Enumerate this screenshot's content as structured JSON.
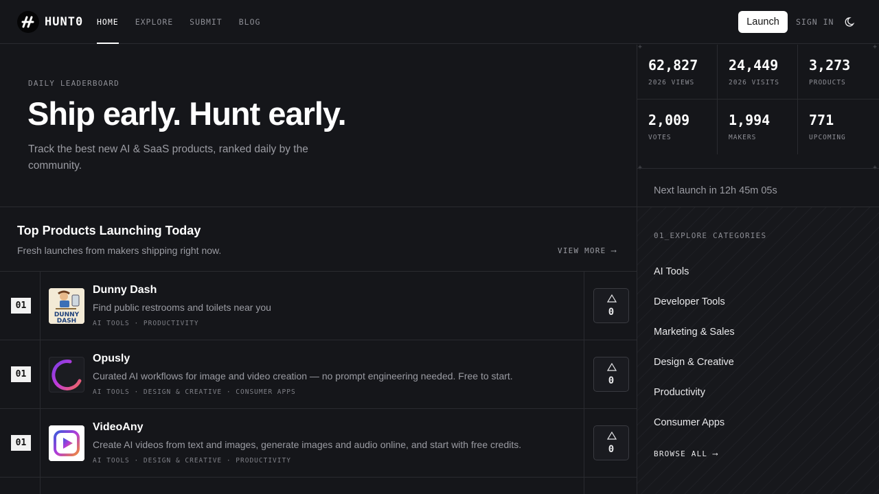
{
  "header": {
    "brand": "HUNT0",
    "nav": [
      "HOME",
      "EXPLORE",
      "SUBMIT",
      "BLOG"
    ],
    "active_nav": "HOME",
    "launch_label": "Launch",
    "signin_label": "SIGN IN"
  },
  "hero": {
    "eyebrow": "DAILY LEADERBOARD",
    "headline": "Ship early. Hunt early.",
    "subline": "Track the best new AI & SaaS products, ranked daily by the community."
  },
  "stats": [
    {
      "value": "62,827",
      "label": "2026 VIEWS"
    },
    {
      "value": "24,449",
      "label": "2026 VISITS"
    },
    {
      "value": "3,273",
      "label": "PRODUCTS"
    },
    {
      "value": "2,009",
      "label": "VOTES"
    },
    {
      "value": "1,994",
      "label": "MAKERS"
    },
    {
      "value": "771",
      "label": "UPCOMING"
    }
  ],
  "next_launch": "Next launch in 12h 45m 05s",
  "products_section": {
    "title": "Top Products Launching Today",
    "subtitle": "Fresh launches from makers shipping right now.",
    "view_more": "VIEW MORE ⟶",
    "items": [
      {
        "rank": "01",
        "name": "Dunny Dash",
        "description": "Find public restrooms and toilets near you",
        "tags": "AI TOOLS · PRODUCTIVITY",
        "votes": "0",
        "thumb_text_1": "DUNNY",
        "thumb_text_2": "DASH"
      },
      {
        "rank": "01",
        "name": "Opusly",
        "description": "Curated AI workflows for image and video creation — no prompt engineering needed. Free to start.",
        "tags": "AI TOOLS · DESIGN & CREATIVE · CONSUMER APPS",
        "votes": "0"
      },
      {
        "rank": "01",
        "name": "VideoAny",
        "description": "Create AI videos from text and images, generate images and audio online, and start with free credits.",
        "tags": "AI TOOLS · DESIGN & CREATIVE · PRODUCTIVITY",
        "votes": "0"
      }
    ]
  },
  "categories": {
    "title": "01_EXPLORE CATEGORIES",
    "items": [
      "AI Tools",
      "Developer Tools",
      "Marketing & Sales",
      "Design & Creative",
      "Productivity",
      "Consumer Apps"
    ],
    "browse_all": "BROWSE ALL ⟶"
  },
  "icons": {
    "logo": "logo-mark-icon",
    "theme": "moon-icon",
    "upvote": "triangle-up-icon"
  },
  "colors": {
    "background": "#15161a",
    "border": "#2a2b30",
    "text": "#e8e8ea",
    "muted": "#9b9ca3",
    "accent": "#ffffff"
  }
}
